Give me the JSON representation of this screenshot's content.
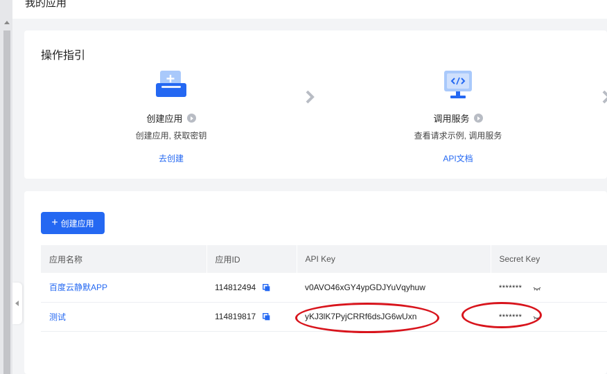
{
  "page": {
    "title": "我的应用"
  },
  "guide": {
    "title": "操作指引",
    "steps": [
      {
        "name": "创建应用",
        "desc": "创建应用, 获取密钥",
        "link": "去创建",
        "icon": "add-app-icon"
      },
      {
        "name": "调用服务",
        "desc": "查看请求示例, 调用服务",
        "link": "API文档",
        "icon": "api-code-icon"
      }
    ]
  },
  "apps": {
    "create_button": "创建应用",
    "columns": [
      "应用名称",
      "应用ID",
      "API Key",
      "Secret Key"
    ],
    "rows": [
      {
        "name": "百度云静默APP",
        "id": "114812494",
        "api_key": "v0AVO46xGY4ypGDJYuVqyhuw",
        "secret": "*******"
      },
      {
        "name": "测试",
        "id": "114819817",
        "api_key": "yKJ3lK7PyjCRRf6dsJG6wUxn",
        "secret": "*******"
      }
    ]
  },
  "colors": {
    "accent": "#2468f2",
    "annotation": "#d8141c"
  }
}
